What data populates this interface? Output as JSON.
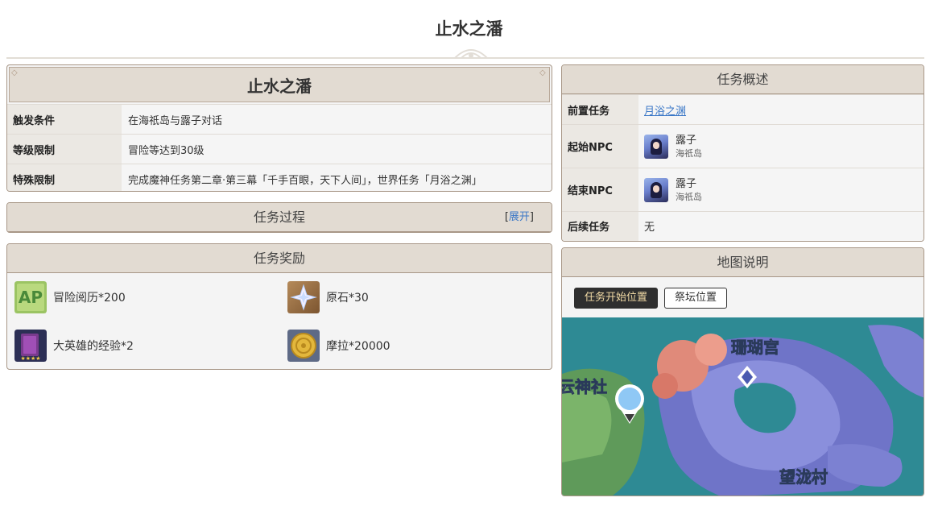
{
  "page": {
    "title": "止水之潘"
  },
  "info": {
    "title": "止水之潘",
    "rows": [
      {
        "key": "触发条件",
        "value": "在海祇岛与露子对话"
      },
      {
        "key": "等级限制",
        "value": "冒险等达到30级"
      },
      {
        "key": "特殊限制",
        "value": "完成魔神任务第二章·第三幕「千手百眼，天下人间」，世界任务「月浴之渊」"
      }
    ]
  },
  "process": {
    "title": "任务过程",
    "expand_open": "[",
    "expand_label": "展开",
    "expand_close": "]"
  },
  "rewards": {
    "title": "任务奖励",
    "items": [
      {
        "label": "冒险阅历*200",
        "icon": "adventure-exp-icon"
      },
      {
        "label": "原石*30",
        "icon": "primogem-icon"
      },
      {
        "label": "大英雄的经验*2",
        "icon": "heros-wit-icon"
      },
      {
        "label": "摩拉*20000",
        "icon": "mora-icon"
      }
    ]
  },
  "summary": {
    "title": "任务概述",
    "prereq_key": "前置任务",
    "prereq_value": "月浴之渊",
    "start_key": "起始NPC",
    "start_npc": {
      "name": "露子",
      "location": "海祇岛"
    },
    "end_key": "结束NPC",
    "end_npc": {
      "name": "露子",
      "location": "海祇岛"
    },
    "next_key": "后续任务",
    "next_value": "无"
  },
  "map": {
    "title": "地图说明",
    "tabs": [
      {
        "label": "任务开始位置",
        "active": true
      },
      {
        "label": "祭坛位置",
        "active": false
      }
    ],
    "labels": {
      "coral_palace": "珊瑚宫",
      "shrine": "云神社",
      "village": "望泷村"
    }
  },
  "colors": {
    "header_bg": "#e2dbd2",
    "border": "#a89787",
    "link": "#3a77c7",
    "tab_active_bg": "#2f2f2f",
    "tab_active_text": "#f0d9a5"
  }
}
